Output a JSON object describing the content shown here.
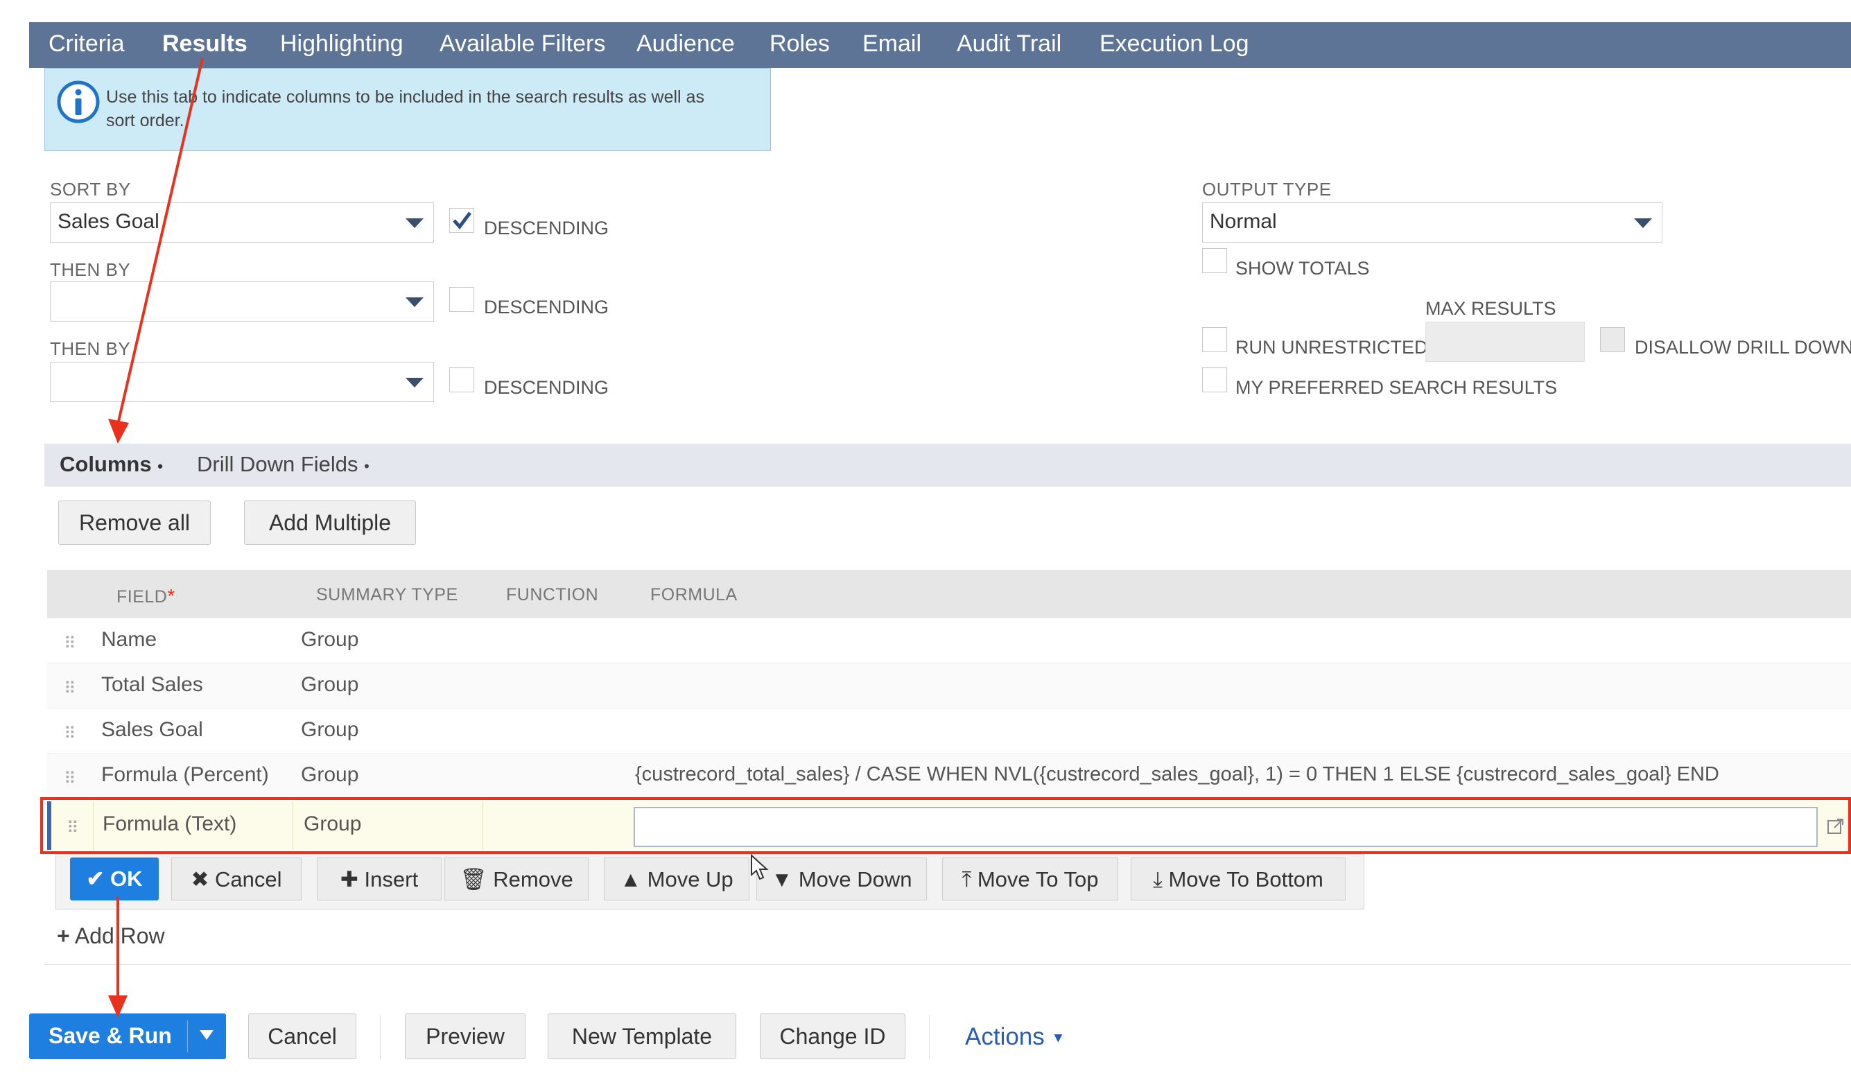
{
  "nav": {
    "tabs": [
      "Criteria",
      "Results",
      "Highlighting",
      "Available Filters",
      "Audience",
      "Roles",
      "Email",
      "Audit Trail",
      "Execution Log"
    ],
    "active_index": 1
  },
  "info": {
    "text": "Use this tab to indicate columns to be included in the search results as well as sort order."
  },
  "sort": {
    "sort_by_label": "SORT BY",
    "sort_by_value": "Sales Goal",
    "then_by_label": "THEN BY",
    "then_by_value_1": "",
    "then_by_value_2": "",
    "descending_label": "DESCENDING",
    "descending_checked": [
      true,
      false,
      false
    ]
  },
  "output": {
    "output_type_label": "OUTPUT TYPE",
    "output_type_value": "Normal",
    "show_totals": "SHOW TOTALS",
    "max_results": "MAX RESULTS",
    "run_unrestricted": "RUN UNRESTRICTED",
    "disallow_drill_down": "DISALLOW DRILL DOWN",
    "my_preferred": "MY PREFERRED SEARCH RESULTS"
  },
  "subtabs": {
    "columns": "Columns",
    "drill_down": "Drill Down Fields",
    "dot": "•"
  },
  "actions": {
    "remove_all": "Remove all",
    "add_multiple": "Add Multiple"
  },
  "table": {
    "headers": {
      "field": "FIELD",
      "required": "*",
      "summary": "SUMMARY TYPE",
      "function": "FUNCTION",
      "formula": "FORMULA"
    },
    "rows": [
      {
        "field": "Name",
        "summary": "Group",
        "formula": ""
      },
      {
        "field": "Total Sales",
        "summary": "Group",
        "formula": ""
      },
      {
        "field": "Sales Goal",
        "summary": "Group",
        "formula": ""
      },
      {
        "field": "Formula (Percent)",
        "summary": "Group",
        "formula": "{custrecord_total_sales} / CASE WHEN NVL({custrecord_sales_goal}, 1) = 0 THEN 1 ELSE {custrecord_sales_goal} END"
      }
    ],
    "edit_row": {
      "field": "Formula (Text)",
      "summary": "Group",
      "formula": ""
    }
  },
  "row_toolbar": {
    "ok": "OK",
    "cancel": "Cancel",
    "insert": "Insert",
    "remove": "Remove",
    "move_up": "Move Up",
    "move_down": "Move Down",
    "move_top": "Move To Top",
    "move_bottom": "Move To Bottom"
  },
  "add_row": "Add Row",
  "footer": {
    "save_run": "Save & Run",
    "cancel": "Cancel",
    "preview": "Preview",
    "new_template": "New Template",
    "change_id": "Change ID",
    "actions": "Actions"
  },
  "colors": {
    "nav": "#5d7497",
    "primary": "#1f7fe0",
    "annotation": "#e8321e",
    "info_bg": "#cdeaf7"
  }
}
